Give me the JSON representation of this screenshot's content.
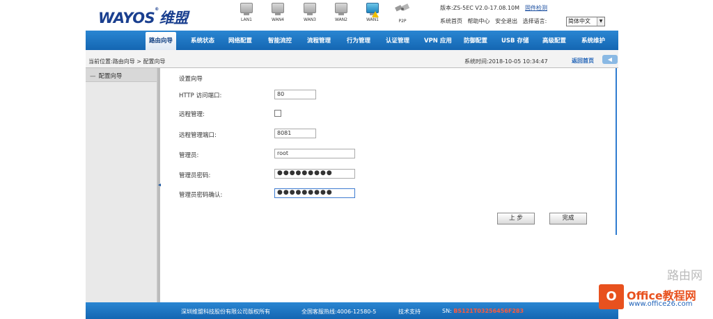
{
  "header": {
    "logo_text": "WAYOS",
    "logo_reg": "®",
    "logo_cn": "维盟",
    "ports": [
      {
        "label": "LAN1",
        "active": false
      },
      {
        "label": "WAN4",
        "active": false
      },
      {
        "label": "WAN3",
        "active": false
      },
      {
        "label": "WAN2",
        "active": false
      },
      {
        "label": "WAN1",
        "active": true,
        "warning": true
      }
    ],
    "p2p_label": "P2P",
    "version_text": "版本:ZS-5EC V2.0-17.08.10M",
    "upgrade_link": "固件检测",
    "links": [
      "系统首页",
      "帮助中心",
      "安全退出",
      "选择语言:"
    ],
    "language_value": "简体中文"
  },
  "nav": {
    "items": [
      "路由向导",
      "系统状态",
      "网络配置",
      "智能流控",
      "流程管理",
      "行为管理",
      "认证管理",
      "VPN 应用",
      "防御配置",
      "USB 存储",
      "高级配置",
      "系统维护"
    ],
    "active_index": 0
  },
  "breadcrumb": {
    "text": "当前位置:路由向导 > 配置向导",
    "system_time": "系统时间:2018-10-05 10:34:47",
    "back_home": "返回首页"
  },
  "sidebar": {
    "item": "配置向导"
  },
  "form": {
    "title": "设置向导",
    "http_port_label": "HTTP 访问端口:",
    "http_port_value": "80",
    "remote_mgmt_label": "远程管理:",
    "remote_mgmt_checked": false,
    "remote_port_label": "远程管理端口:",
    "remote_port_value": "8081",
    "admin_label": "管理员:",
    "admin_value": "root",
    "admin_pw_label": "管理员密码:",
    "admin_pw_value": "●●●●●●●●●",
    "admin_pw_confirm_label": "管理员密码确认:",
    "admin_pw_confirm_value": "●●●●●●●●●",
    "prev_button": "上 步",
    "finish_button": "完成"
  },
  "footer": {
    "copyright": "深圳维盟科技股份有限公司版权所有",
    "hotline": "全国客服热线:4006-12580-5",
    "support": "技术支持",
    "sn_label": "SN:",
    "sn_value": "BS121T03256456F283"
  },
  "watermark": {
    "logo_char": "O",
    "title": "Office教程网",
    "url": "www.office26.com",
    "corner": "路由网"
  },
  "colors": {
    "nav_blue": "#1a76c6",
    "logo_blue": "#1a3f8f",
    "serial_red": "#ff5a3a",
    "watermark_orange": "#e8511e"
  }
}
